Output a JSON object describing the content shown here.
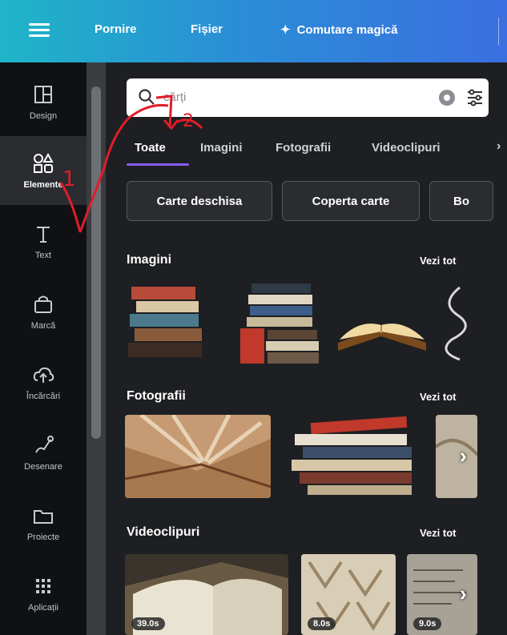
{
  "topbar": {
    "menu_icon": "hamburger-icon",
    "home": "Pornire",
    "file": "Fișier",
    "magic_switch": "Comutare magică",
    "magic_icon": "sparkle-icon"
  },
  "sidebar": {
    "items": [
      {
        "label": "Design",
        "icon": "layout-icon"
      },
      {
        "label": "Elemente",
        "icon": "shapes-icon"
      },
      {
        "label": "Text",
        "icon": "text-icon"
      },
      {
        "label": "Marcă",
        "icon": "brand-icon"
      },
      {
        "label": "Încărcări",
        "icon": "upload-cloud-icon"
      },
      {
        "label": "Desenare",
        "icon": "draw-icon"
      },
      {
        "label": "Proiecte",
        "icon": "folder-icon"
      },
      {
        "label": "Aplicații",
        "icon": "apps-grid-icon"
      }
    ]
  },
  "search": {
    "query": "cărți"
  },
  "tabs": [
    "Toate",
    "Imagini",
    "Fotografii",
    "Videoclipuri"
  ],
  "chips": [
    "Carte deschisa",
    "Coperta carte",
    "Bo"
  ],
  "sections": {
    "images": {
      "title": "Imagini",
      "see_all": "Vezi tot"
    },
    "photos": {
      "title": "Fotografii",
      "see_all": "Vezi tot"
    },
    "videos": {
      "title": "Videoclipuri",
      "see_all": "Vezi tot",
      "durations": [
        "39.0s",
        "8.0s",
        "9.0s"
      ]
    }
  },
  "annotation": {
    "labels": [
      "1",
      "2"
    ],
    "color": "#e11d2a"
  },
  "colors": {
    "accent": "#8b5cf6",
    "topbar_start": "#1fb5c7",
    "topbar_end": "#3a6fe0"
  }
}
